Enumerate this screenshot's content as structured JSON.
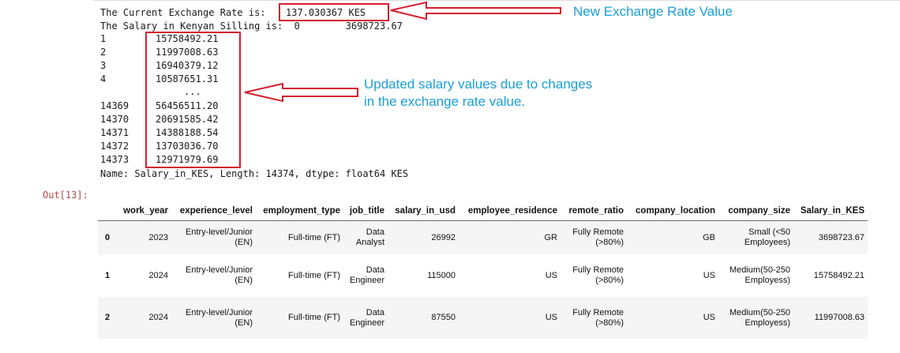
{
  "output": {
    "rate_line": "The Current Exchange Rate is:",
    "rate_value": "137.030367 KES",
    "salary_line": "The Salary in Kenyan Silling is:  0        3698723.67",
    "series_rows": [
      {
        "index": "1",
        "value": "15758492.21"
      },
      {
        "index": "2",
        "value": "11997008.63"
      },
      {
        "index": "3",
        "value": "16940379.12"
      },
      {
        "index": "4",
        "value": "10587651.31"
      },
      {
        "index": "",
        "value": "..."
      },
      {
        "index": "14369",
        "value": "56456511.20"
      },
      {
        "index": "14370",
        "value": "20691585.42"
      },
      {
        "index": "14371",
        "value": "14388188.54"
      },
      {
        "index": "14372",
        "value": "13703036.70"
      },
      {
        "index": "14373",
        "value": "12971979.69"
      }
    ],
    "name_line": "Name: Salary_in_KES, Length: 14374, dtype: float64 KES"
  },
  "annotations": {
    "rate_note": "New Exchange Rate Value",
    "salary_note_line1": "Updated salary values due to changes",
    "salary_note_line2": "in the exchange rate value.",
    "accent_color": "#d2202f",
    "text_color": "#1a9fd6"
  },
  "prompt": "Out[13]:",
  "table": {
    "columns": [
      "",
      "work_year",
      "experience_level",
      "employment_type",
      "job_title",
      "salary_in_usd",
      "employee_residence",
      "remote_ratio",
      "company_location",
      "company_size",
      "Salary_in_KES"
    ],
    "rows": [
      {
        "index": "0",
        "work_year": "2023",
        "experience_level": "Entry-level/Junior (EN)",
        "employment_type": "Full-time (FT)",
        "job_title": "Data Analyst",
        "salary_in_usd": "26992",
        "employee_residence": "GR",
        "remote_ratio": "Fully Remote (>80%)",
        "company_location": "GB",
        "company_size": "Small (<50 Employees)",
        "Salary_in_KES": "3698723.67"
      },
      {
        "index": "1",
        "work_year": "2024",
        "experience_level": "Entry-level/Junior (EN)",
        "employment_type": "Full-time (FT)",
        "job_title": "Data Engineer",
        "salary_in_usd": "115000",
        "employee_residence": "US",
        "remote_ratio": "Fully Remote (>80%)",
        "company_location": "US",
        "company_size": "Medium(50-250 Employess)",
        "Salary_in_KES": "15758492.21"
      },
      {
        "index": "2",
        "work_year": "2024",
        "experience_level": "Entry-level/Junior (EN)",
        "employment_type": "Full-time (FT)",
        "job_title": "Data Engineer",
        "salary_in_usd": "87550",
        "employee_residence": "US",
        "remote_ratio": "Fully Remote (>80%)",
        "company_location": "US",
        "company_size": "Medium(50-250 Employess)",
        "Salary_in_KES": "11997008.63"
      }
    ]
  }
}
